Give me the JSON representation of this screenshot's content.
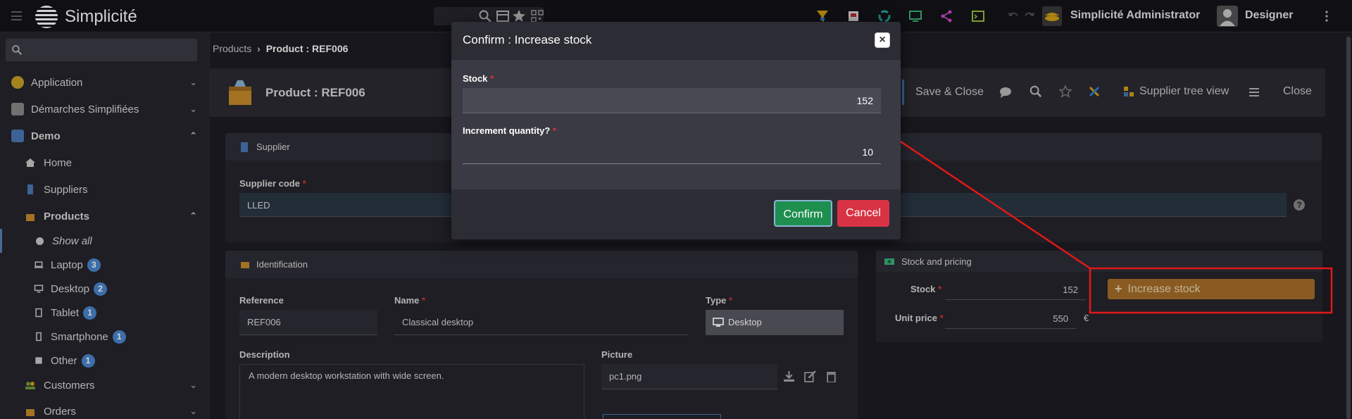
{
  "topbar": {
    "brand": "Simplicité",
    "user_label": "Simplicité Administrator",
    "designer_label": "Designer"
  },
  "sidebar": {
    "items": [
      {
        "label": "Application",
        "icon": "app-icon",
        "color": "#c9a227"
      },
      {
        "label": "Démarches Simplifiées",
        "icon": "form-icon",
        "color": "#8a8a8a"
      },
      {
        "label": "Demo",
        "icon": "demo-icon",
        "color": "#4a78b8"
      },
      {
        "label": "Home",
        "icon": "home-icon"
      },
      {
        "label": "Suppliers",
        "icon": "building-icon",
        "color": "#4a78b8"
      },
      {
        "label": "Products",
        "icon": "box-icon",
        "color": "#c78b2a"
      },
      {
        "label": "Show all",
        "icon": "circle-icon"
      },
      {
        "label": "Laptop",
        "icon": "laptop-icon",
        "count": "3"
      },
      {
        "label": "Desktop",
        "icon": "desktop-icon",
        "count": "2"
      },
      {
        "label": "Tablet",
        "icon": "tablet-icon",
        "count": "1"
      },
      {
        "label": "Smartphone",
        "icon": "phone-icon",
        "count": "1"
      },
      {
        "label": "Other",
        "icon": "other-icon",
        "count": "1"
      },
      {
        "label": "Customers",
        "icon": "users-icon",
        "color": "#6b9b3a"
      },
      {
        "label": "Orders",
        "icon": "orders-icon",
        "color": "#c78b2a"
      }
    ]
  },
  "breadcrumb": {
    "parent": "Products",
    "current": "Product : REF006"
  },
  "form": {
    "title": "Product : REF006",
    "actions": {
      "save_close": "Save & Close",
      "supplier_tree": "Supplier tree view",
      "close": "Close"
    },
    "supplier_section": "Supplier",
    "supplier_code_label": "Supplier code",
    "supplier_code_value": "LLED",
    "identification_section": "Identification",
    "reference_label": "Reference",
    "reference_value": "REF006",
    "name_label": "Name",
    "name_value": "Classical desktop",
    "type_label": "Type",
    "type_value": "Desktop",
    "description_label": "Description",
    "description_value": "A modern desktop workstation with wide screen.",
    "picture_label": "Picture",
    "picture_value": "pc1.png",
    "stock_section": "Stock and pricing",
    "stock_label": "Stock",
    "stock_value": "152",
    "unit_price_label": "Unit price",
    "unit_price_value": "550",
    "currency": "€",
    "increase_stock_label": "Increase stock"
  },
  "modal": {
    "title": "Confirm : Increase stock",
    "stock_label": "Stock",
    "stock_value": "152",
    "increment_label": "Increment quantity?",
    "increment_value": "10",
    "confirm_label": "Confirm",
    "cancel_label": "Cancel"
  },
  "colors": {
    "accent_orange": "#a8702a",
    "confirm_green": "#1e8f4e",
    "cancel_red": "#d83344",
    "annotation_red": "#e21818"
  }
}
